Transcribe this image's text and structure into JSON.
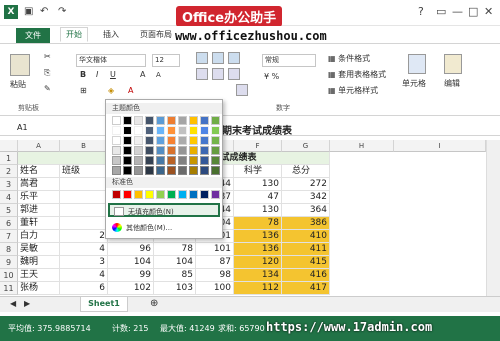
{
  "titlebar": {
    "app_icon": "excel-logo-icon",
    "banner": "Office办公助手"
  },
  "tabs": {
    "file": "文件",
    "home": "开始",
    "insert": "插入",
    "layout": "页面布局",
    "website": "www.officezhushou.com",
    "login": "登录"
  },
  "ribbon": {
    "paste": "粘贴",
    "clipboard": "剪贴板",
    "font_name": "华文楷体",
    "font_size": "12",
    "bold": "B",
    "italic": "I",
    "underline": "U",
    "grow_font": "A",
    "shrink_font": "A",
    "number_format": "常规",
    "number_group": "数字",
    "cond_format": "条件格式",
    "table_format": "套用表格格式",
    "cell_style": "单元格样式",
    "cells": "单元格",
    "editing": "编辑"
  },
  "formula_bar": {
    "name_box": "A1",
    "content": "期末考试成绩表"
  },
  "columns": [
    "A",
    "B",
    "C",
    "D",
    "E",
    "F",
    "G",
    "H",
    "I"
  ],
  "rows": [
    "1",
    "2",
    "3",
    "4",
    "5",
    "6",
    "7",
    "8",
    "9",
    "10",
    "11"
  ],
  "title_row": "试成绩表",
  "header": {
    "name": "姓名",
    "class": "班级",
    "foreign": "外语",
    "science": "科学",
    "total": "总分"
  },
  "data_rows": [
    {
      "name": "嵩君",
      "b": "",
      "c": "",
      "d": "20",
      "e": "44",
      "f": "130",
      "g": "272"
    },
    {
      "name": "乐平",
      "b": "",
      "c": "",
      "d": "12",
      "e": "87",
      "f": "47",
      "g": "342"
    },
    {
      "name": "郭进",
      "b": "",
      "c": "",
      "d": "12",
      "e": "44",
      "f": "130",
      "g": "364"
    },
    {
      "name": "董轩",
      "b": "",
      "c": "",
      "d": "03",
      "e": "104",
      "f": "78",
      "g": "386"
    },
    {
      "name": "白力",
      "b": "2",
      "c": "96",
      "d": "78",
      "e": "101",
      "f": "136",
      "g": "410"
    },
    {
      "name": "吴敏",
      "b": "4",
      "c": "96",
      "d": "78",
      "e": "101",
      "f": "136",
      "g": "411"
    },
    {
      "name": "魏明",
      "b": "3",
      "c": "104",
      "d": "104",
      "e": "87",
      "f": "120",
      "g": "415"
    },
    {
      "name": "王天",
      "b": "4",
      "c": "99",
      "d": "85",
      "e": "98",
      "f": "134",
      "g": "416"
    },
    {
      "name": "张杨",
      "b": "6",
      "c": "102",
      "d": "103",
      "e": "100",
      "f": "112",
      "g": "417"
    }
  ],
  "palette": {
    "theme_colors": "主题颜色",
    "standard_colors": "标准色",
    "no_fill": "无填充颜色(N)",
    "more_colors": "其他颜色(M)...",
    "theme_top": [
      "#ffffff",
      "#000000",
      "#e7e6e6",
      "#44546a",
      "#5b9bd5",
      "#ed7d31",
      "#a5a5a5",
      "#ffc000",
      "#4472c4",
      "#70ad47"
    ],
    "standard": [
      "#c00000",
      "#ff0000",
      "#ffc000",
      "#ffff00",
      "#92d050",
      "#00b050",
      "#00b0f0",
      "#0070c0",
      "#002060",
      "#7030a0"
    ]
  },
  "sheet_tab": "Sheet1",
  "status": {
    "avg": "平均值: 375.9885714",
    "count": "计数: 215",
    "max": "最大值: 41249",
    "sum": "求和: 65790",
    "watermark": "https://www.17admin.com"
  },
  "colors": {
    "accent": "#217346",
    "highlight": "#e7f3e2",
    "fill": "#f4c430"
  }
}
